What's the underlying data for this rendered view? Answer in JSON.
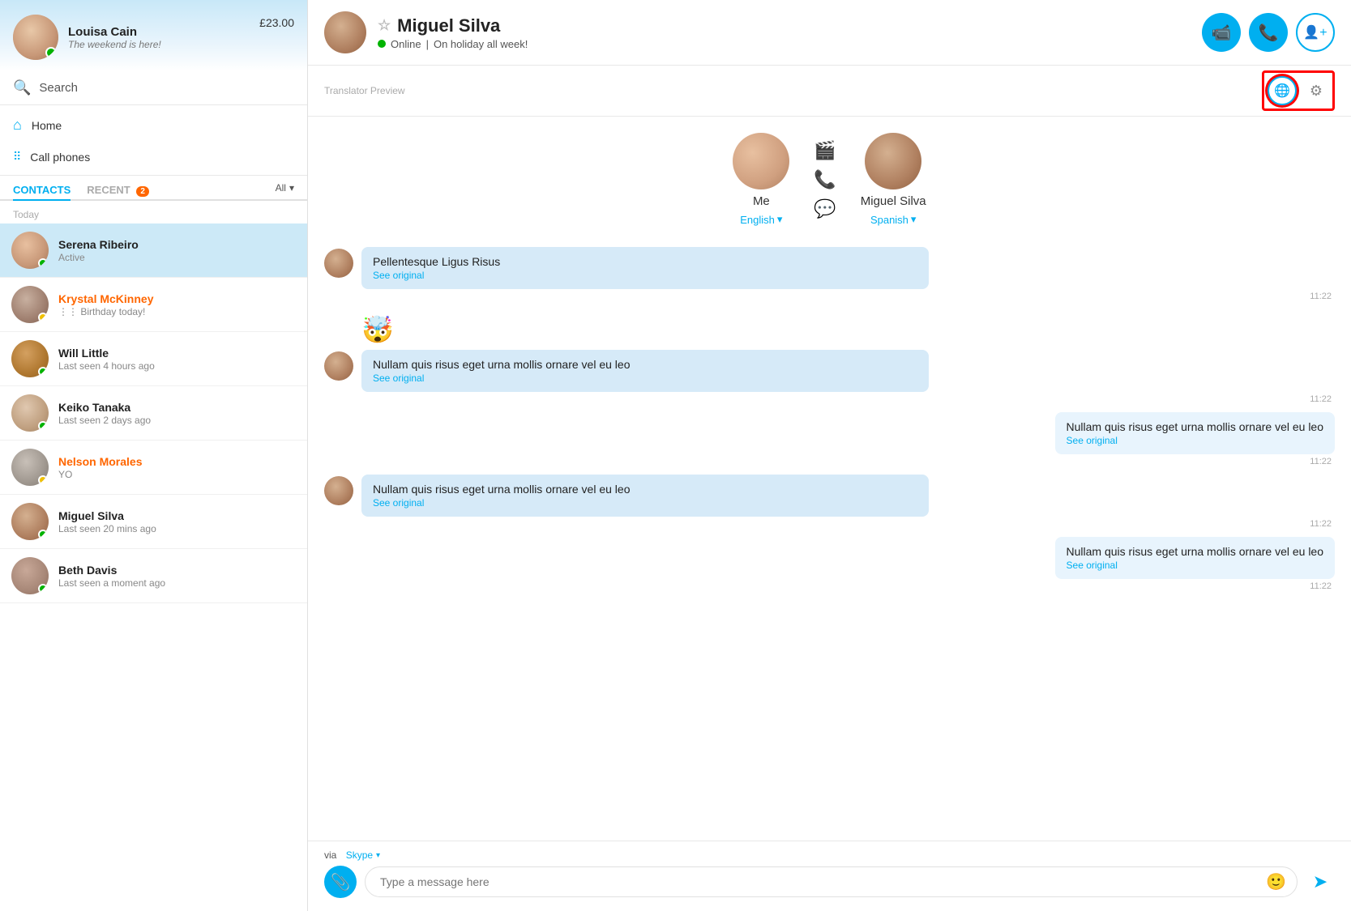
{
  "sidebar": {
    "profile": {
      "name": "Louisa Cain",
      "status": "The weekend is here!",
      "credit": "£23.00"
    },
    "search": {
      "placeholder": "Search"
    },
    "nav": [
      {
        "id": "home",
        "label": "Home",
        "icon": "⌂"
      },
      {
        "id": "call-phones",
        "label": "Call phones",
        "icon": "⠿"
      }
    ],
    "tabs": [
      {
        "id": "contacts",
        "label": "CONTACTS",
        "active": true
      },
      {
        "id": "recent",
        "label": "RECENT",
        "badge": "2",
        "active": false
      }
    ],
    "tab_all": "All",
    "section_today": "Today",
    "contacts": [
      {
        "id": "serena",
        "name": "Serena Ribeiro",
        "sub": "Active",
        "dot": "green",
        "active": true,
        "av": "av-serena"
      },
      {
        "id": "krystal",
        "name": "Krystal McKinney",
        "sub": "Birthday today!",
        "dot": "yellow",
        "active": false,
        "av": "av-krystal",
        "name_color": "orange",
        "birthday": true
      },
      {
        "id": "will",
        "name": "Will Little",
        "sub": "Last seen 4 hours ago",
        "dot": "green",
        "active": false,
        "av": "av-will"
      },
      {
        "id": "keiko",
        "name": "Keiko Tanaka",
        "sub": "Last seen 2 days ago",
        "dot": "green",
        "active": false,
        "av": "av-keiko"
      },
      {
        "id": "nelson",
        "name": "Nelson Morales",
        "sub": "YO",
        "dot": "yellow",
        "active": false,
        "av": "av-nelson",
        "name_color": "orange"
      },
      {
        "id": "miguel",
        "name": "Miguel Silva",
        "sub": "Last seen 20 mins ago",
        "dot": "green",
        "active": false,
        "av": "av-miguel"
      },
      {
        "id": "beth",
        "name": "Beth Davis",
        "sub": "Last seen a moment ago",
        "dot": "green",
        "active": false,
        "av": "av-beth"
      }
    ]
  },
  "chat": {
    "contact_name": "Miguel Silva",
    "status_text": "Online",
    "status_detail": "On holiday all week!",
    "translator_label": "Translator Preview",
    "me": {
      "label": "Me",
      "lang": "English",
      "av": "av-me"
    },
    "them": {
      "label": "Miguel Silva",
      "lang": "Spanish",
      "av": "av-miguel"
    },
    "messages": [
      {
        "id": "m1",
        "side": "left",
        "text": "Pellentesque Ligus Risus",
        "see_original": "See original",
        "time": "11:22"
      },
      {
        "id": "m2",
        "side": "emoji",
        "emoji": "🤯"
      },
      {
        "id": "m3",
        "side": "left",
        "text": "Nullam quis risus eget urna mollis ornare vel eu leo",
        "see_original": "See original",
        "time": "11:22"
      },
      {
        "id": "m4",
        "side": "right",
        "text": "Nullam quis risus eget urna mollis ornare vel eu leo",
        "see_original": "See original",
        "time": "11:22"
      },
      {
        "id": "m5",
        "side": "left",
        "text": "Nullam quis risus eget urna mollis ornare vel eu leo",
        "see_original": "See original",
        "time": "11:22"
      },
      {
        "id": "m6",
        "side": "right",
        "text": "Nullam quis risus eget urna mollis ornare vel eu leo",
        "see_original": "See original",
        "time": "11:22"
      }
    ],
    "input_placeholder": "Type a message here",
    "via_skype_label": "via",
    "via_skype_link": "Skype"
  },
  "icons": {
    "search": "🔍",
    "home": "⌂",
    "call_phones": "⠿",
    "video": "📹",
    "phone": "📞",
    "add_contact": "👤",
    "translator": "🌐",
    "gear": "⚙",
    "star": "☆",
    "attach": "📎",
    "emoji": "🙂",
    "send": "➤",
    "chevron_down": "▾",
    "birthday": "🎂",
    "video_icon": "🎬",
    "call_icon": "📞"
  }
}
